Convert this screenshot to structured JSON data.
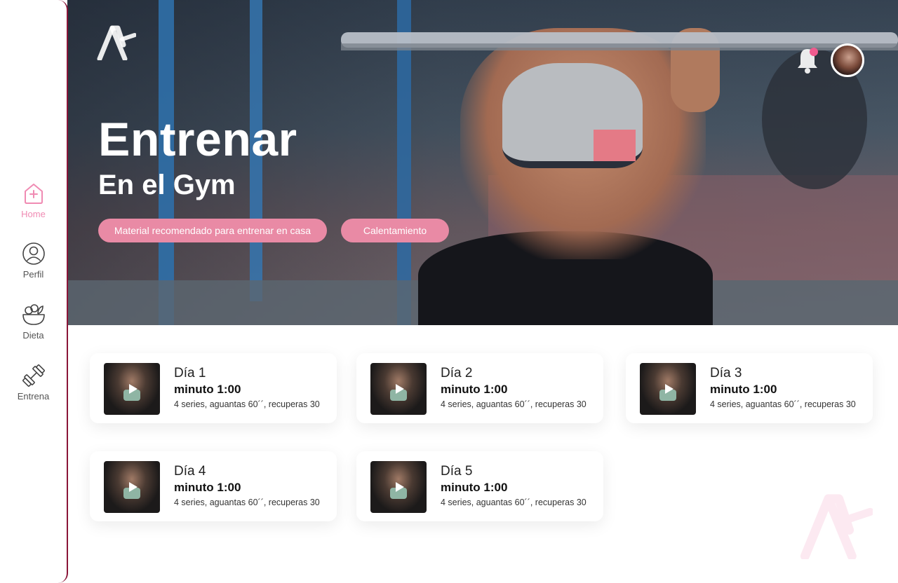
{
  "sidebar": {
    "items": [
      {
        "label": "Home",
        "icon": "home-plus-icon",
        "active": true
      },
      {
        "label": "Perfil",
        "icon": "profile-icon",
        "active": false
      },
      {
        "label": "Dieta",
        "icon": "salad-bowl-icon",
        "active": false
      },
      {
        "label": "Entrena",
        "icon": "dumbbell-icon",
        "active": false
      }
    ]
  },
  "hero": {
    "title": "Entrenar",
    "subtitle": "En el Gym",
    "buttons": [
      {
        "label": "Material recomendado para entrenar en casa"
      },
      {
        "label": "Calentamiento"
      }
    ]
  },
  "header": {
    "notification_icon": "bell-icon",
    "avatar_icon": "avatar"
  },
  "workouts": [
    {
      "day": "Día 1",
      "duration": "minuto 1:00",
      "description": "4 series, aguantas 60´´, recuperas 30"
    },
    {
      "day": "Día 2",
      "duration": "minuto 1:00",
      "description": "4 series, aguantas 60´´, recuperas 30"
    },
    {
      "day": "Día 3",
      "duration": "minuto 1:00",
      "description": "4 series, aguantas 60´´, recuperas 30"
    },
    {
      "day": "Día 4",
      "duration": "minuto 1:00",
      "description": "4 series, aguantas 60´´, recuperas 30"
    },
    {
      "day": "Día 5",
      "duration": "minuto 1:00",
      "description": "4 series, aguantas 60´´, recuperas 30"
    }
  ],
  "colors": {
    "accent_pink": "#e98aa5",
    "active_nav": "#f08bb3",
    "sidebar_border": "#8a1538",
    "notification_dot": "#f05b8e"
  }
}
